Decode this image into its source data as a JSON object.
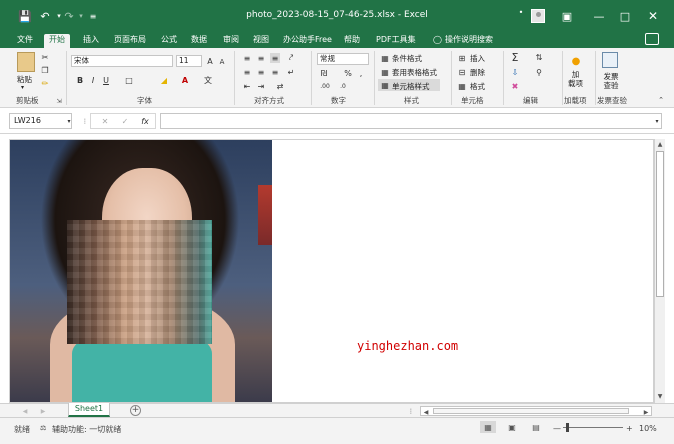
{
  "title_bar": {
    "title": "photo_2023-08-15_07-46-25.xlsx  -  Excel",
    "save_icon": "save-icon",
    "undo_icon": "undo-icon",
    "redo_icon": "redo-icon",
    "customize_icon": "customize-qat-icon",
    "ribbon_display_icon": "ribbon-display-icon",
    "minimize_icon": "minimize-icon",
    "maximize_icon": "maximize-icon",
    "close_icon": "close-icon"
  },
  "tabs": [
    {
      "label": "文件"
    },
    {
      "label": "开始"
    },
    {
      "label": "插入"
    },
    {
      "label": "页面布局"
    },
    {
      "label": "公式"
    },
    {
      "label": "数据"
    },
    {
      "label": "审阅"
    },
    {
      "label": "视图"
    },
    {
      "label": "办公助手Free"
    },
    {
      "label": "帮助"
    },
    {
      "label": "PDF工具集"
    },
    {
      "label": "操作说明搜索"
    }
  ],
  "ribbon": {
    "clipboard": {
      "paste": "粘贴",
      "group": "剪贴板"
    },
    "font": {
      "name": "宋体",
      "size": "11",
      "bold": "B",
      "italic": "I",
      "underline": "U",
      "group": "字体"
    },
    "alignment": {
      "group": "对齐方式"
    },
    "number": {
      "format": "常规",
      "percent": "%",
      "comma": ",",
      "group": "数字"
    },
    "styles": {
      "conditional": "条件格式",
      "table": "套用表格格式",
      "cell_styles": "单元格样式",
      "group": "样式"
    },
    "cells": {
      "insert": "插入",
      "delete": "删除",
      "format": "格式",
      "group": "单元格"
    },
    "editing": {
      "group": "编辑"
    },
    "addins": {
      "label": "加载项",
      "button": "加\n载项"
    },
    "invoice": {
      "button": "发票查验",
      "group": "发票查验"
    }
  },
  "formula_bar": {
    "name_box": "LW216",
    "fx": "fx",
    "formula": ""
  },
  "sheet": {
    "watermark": "yinghezhan.com"
  },
  "sheet_tabs": {
    "active": "Sheet1",
    "add": "+"
  },
  "status_bar": {
    "ready": "就绪",
    "accessibility": "辅助功能: 一切就绪",
    "zoom": "10%"
  },
  "colors": {
    "brand": "#217346",
    "watermark": "#d10000"
  }
}
